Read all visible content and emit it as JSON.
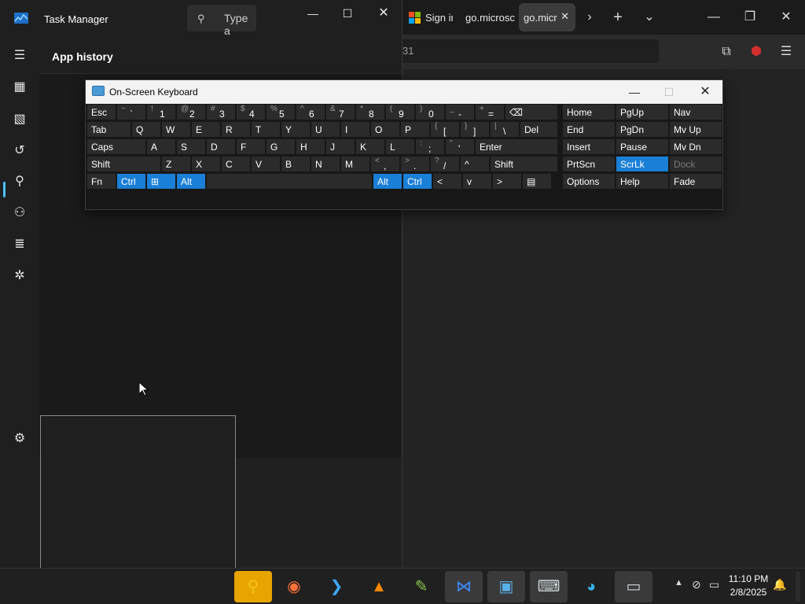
{
  "taskmanager": {
    "title": "Task Manager",
    "search_placeholder": "Type a",
    "page_title": "App history",
    "sidebar": [
      {
        "name": "hamburger-menu-icon",
        "glyph": "☰"
      },
      {
        "name": "processes-icon",
        "glyph": "▦"
      },
      {
        "name": "performance-icon",
        "glyph": "▧"
      },
      {
        "name": "app-history-icon",
        "glyph": "↺"
      },
      {
        "name": "startup-apps-icon",
        "glyph": "⚲"
      },
      {
        "name": "users-icon",
        "glyph": "⚇"
      },
      {
        "name": "details-icon",
        "glyph": "≣"
      },
      {
        "name": "services-icon",
        "glyph": "✲"
      },
      {
        "name": "settings-icon",
        "glyph": "⚙"
      }
    ]
  },
  "browser": {
    "tabs": [
      {
        "label": "Sign ir",
        "active": false
      },
      {
        "label": "go.microsc",
        "active": false
      },
      {
        "label": "go.micr",
        "active": true
      }
    ],
    "address_fragment": "31"
  },
  "osk": {
    "title": "On-Screen Keyboard",
    "row1": [
      {
        "k": "Esc"
      },
      {
        "s": "~",
        "p": "`"
      },
      {
        "s": "!",
        "p": "1"
      },
      {
        "s": "@",
        "p": "2"
      },
      {
        "s": "#",
        "p": "3"
      },
      {
        "s": "$",
        "p": "4"
      },
      {
        "s": "%",
        "p": "5"
      },
      {
        "s": "^",
        "p": "6"
      },
      {
        "s": "&",
        "p": "7"
      },
      {
        "s": "*",
        "p": "8"
      },
      {
        "s": "(",
        "p": "9"
      },
      {
        "s": ")",
        "p": "0"
      },
      {
        "s": "_",
        "p": "-"
      },
      {
        "s": "+",
        "p": "="
      },
      {
        "k": "⌫"
      }
    ],
    "row2": [
      {
        "k": "Tab"
      },
      {
        "k": "Q"
      },
      {
        "k": "W"
      },
      {
        "k": "E"
      },
      {
        "k": "R"
      },
      {
        "k": "T"
      },
      {
        "k": "Y"
      },
      {
        "k": "U"
      },
      {
        "k": "I"
      },
      {
        "k": "O"
      },
      {
        "k": "P"
      },
      {
        "s": "{",
        "p": "["
      },
      {
        "s": "}",
        "p": "]"
      },
      {
        "s": "|",
        "p": "\\"
      },
      {
        "k": "Del"
      }
    ],
    "row3": [
      {
        "k": "Caps"
      },
      {
        "k": "A"
      },
      {
        "k": "S"
      },
      {
        "k": "D"
      },
      {
        "k": "F"
      },
      {
        "k": "G"
      },
      {
        "k": "H"
      },
      {
        "k": "J"
      },
      {
        "k": "K"
      },
      {
        "k": "L"
      },
      {
        "s": ":",
        "p": ";"
      },
      {
        "s": "\"",
        "p": "'"
      },
      {
        "k": "Enter"
      }
    ],
    "row4": [
      {
        "k": "Shift"
      },
      {
        "k": "Z"
      },
      {
        "k": "X"
      },
      {
        "k": "C"
      },
      {
        "k": "V"
      },
      {
        "k": "B"
      },
      {
        "k": "N"
      },
      {
        "k": "M"
      },
      {
        "s": "<",
        "p": ","
      },
      {
        "s": ">",
        "p": "."
      },
      {
        "s": "?",
        "p": "/"
      },
      {
        "k": "^"
      },
      {
        "k": "Shift"
      }
    ],
    "row5": [
      {
        "k": "Fn"
      },
      {
        "k": "Ctrl",
        "blue": true
      },
      {
        "k": "⊞",
        "blue": true
      },
      {
        "k": "Alt",
        "blue": true
      },
      {
        "k": ""
      },
      {
        "k": "Alt",
        "blue": true
      },
      {
        "k": "Ctrl",
        "blue": true
      },
      {
        "k": "<"
      },
      {
        "k": "v"
      },
      {
        "k": ">"
      },
      {
        "k": "▤"
      }
    ],
    "nav": [
      [
        {
          "k": "Home"
        },
        {
          "k": "PgUp"
        },
        {
          "k": "Nav"
        }
      ],
      [
        {
          "k": "End"
        },
        {
          "k": "PgDn"
        },
        {
          "k": "Mv Up"
        }
      ],
      [
        {
          "k": "Insert"
        },
        {
          "k": "Pause"
        },
        {
          "k": "Mv Dn"
        }
      ],
      [
        {
          "k": "PrtScn"
        },
        {
          "k": "ScrLk",
          "blue": true
        },
        {
          "k": "Dock",
          "dim": true
        }
      ],
      [
        {
          "k": "Options"
        },
        {
          "k": "Help"
        },
        {
          "k": "Fade"
        }
      ]
    ]
  },
  "taskbar": {
    "time": "11:10 PM",
    "date": "2/8/2025",
    "apps": [
      {
        "name": "search-app-icon",
        "glyph": "⚲",
        "color": "#f5c518",
        "bg": "#e8a400"
      },
      {
        "name": "firefox-icon",
        "glyph": "◉",
        "color": "#ff7139"
      },
      {
        "name": "vscode-icon",
        "glyph": "❯",
        "color": "#3ea6ff"
      },
      {
        "name": "vlc-icon",
        "glyph": "▲",
        "color": "#ff8800"
      },
      {
        "name": "notepad-icon",
        "glyph": "✎",
        "color": "#8bc34a"
      },
      {
        "name": "dualmonitor-icon",
        "glyph": "⋈",
        "color": "#3c8cff"
      },
      {
        "name": "photos-icon",
        "glyph": "▣",
        "color": "#5ab0e8"
      },
      {
        "name": "keyboard-app-icon",
        "glyph": "⌨",
        "color": "#cfd8dc"
      },
      {
        "name": "edge-icon",
        "glyph": "◕",
        "color": "#33b3e6"
      },
      {
        "name": "remote-desktop-icon",
        "glyph": "▭",
        "color": "#cfd8dc"
      }
    ]
  }
}
